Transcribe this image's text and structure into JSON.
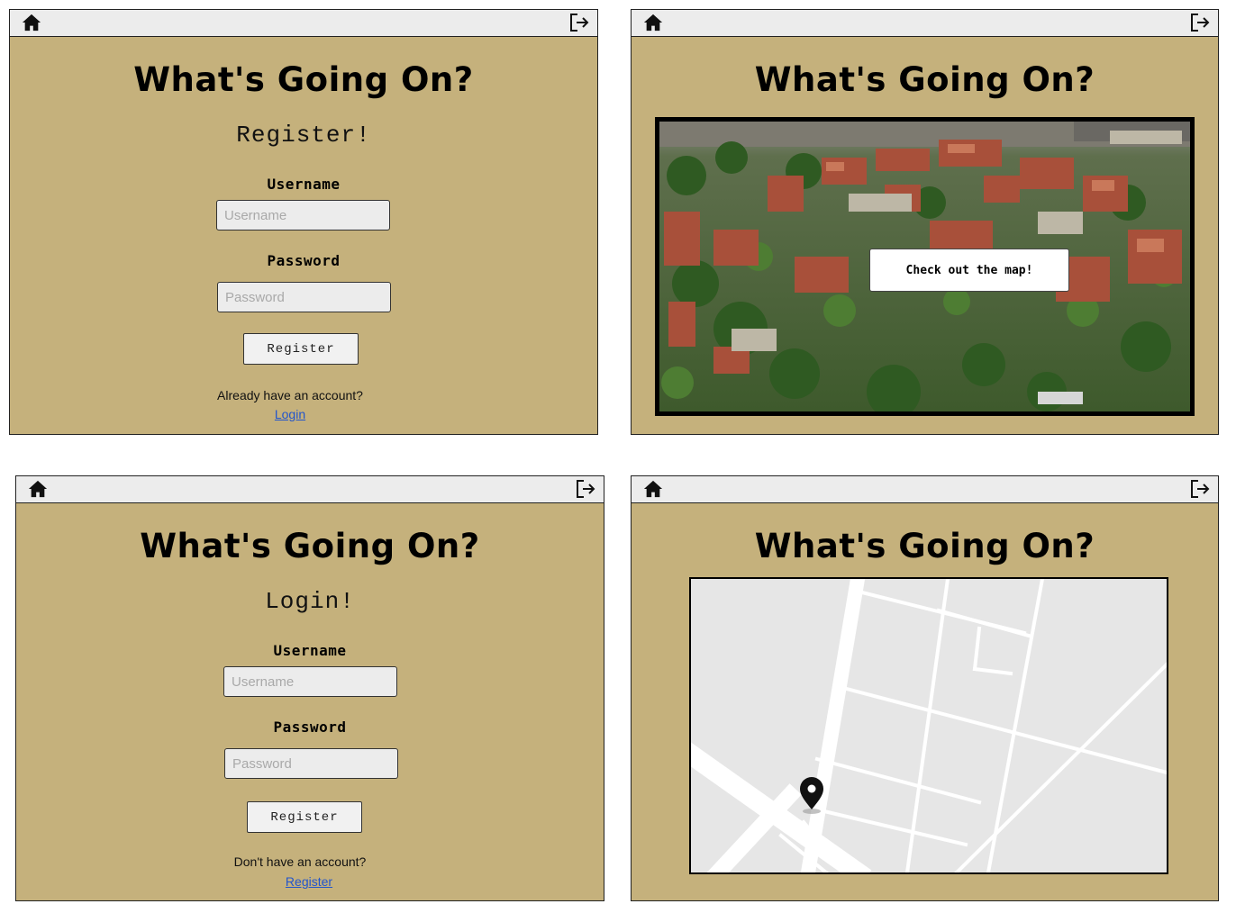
{
  "app": {
    "title": "What's Going On?"
  },
  "icons": {
    "home": "home-icon",
    "logout": "logout-icon",
    "pin": "map-pin-icon"
  },
  "colors": {
    "panel_bg": "#c5b17c",
    "topbar_bg": "#ececec",
    "link": "#2255cc",
    "map_bg": "#e6e6e6"
  },
  "register_page": {
    "heading": "Register!",
    "username_label": "Username",
    "username_placeholder": "Username",
    "password_label": "Password",
    "password_placeholder": "Password",
    "submit_label": "Register",
    "prompt": "Already have an account?",
    "link": "Login"
  },
  "home_page": {
    "map_button": "Check out the map!"
  },
  "login_page": {
    "heading": "Login!",
    "username_label": "Username",
    "username_placeholder": "Username",
    "password_label": "Password",
    "password_placeholder": "Password",
    "submit_label": "Register",
    "prompt": "Don't have an account?",
    "link": "Register"
  },
  "map_page": {}
}
